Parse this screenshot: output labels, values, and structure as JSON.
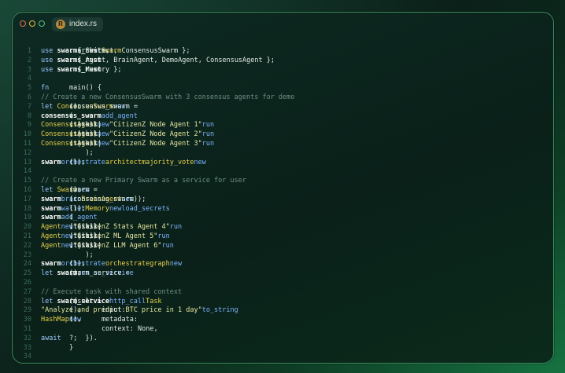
{
  "window": {
    "tab_title": "index.rs",
    "tab_icon": "rust-file-icon",
    "controls": [
      "close",
      "minimize",
      "maximize"
    ]
  },
  "editor": {
    "lines": [
      {
        "n": "1",
        "t": [
          [
            "kw",
            "use "
          ],
          [
            "bold",
            "swarms_rust"
          ],
          [
            "txt",
            "::{ Swarm, "
          ],
          [
            "ty",
            "Swarm"
          ],
          [
            "txt",
            "::architect, ConsensusSwarm };"
          ]
        ]
      },
      {
        "n": "2",
        "t": [
          [
            "kw",
            "use "
          ],
          [
            "bold",
            "swarms_rust"
          ],
          [
            "txt",
            "::{ Agent, BrainAgent, DemoAgent, ConsensusAgent };"
          ]
        ]
      },
      {
        "n": "3",
        "t": [
          [
            "kw",
            "use "
          ],
          [
            "bold",
            "swarms_rust"
          ],
          [
            "txt",
            "::{ Memory };"
          ]
        ]
      },
      {
        "n": "4",
        "t": []
      },
      {
        "n": "5",
        "t": [
          [
            "kw",
            "fn "
          ],
          [
            "txt",
            "main() {"
          ]
        ]
      },
      {
        "n": "6",
        "t": [
          [
            "txt",
            "    "
          ],
          [
            "cm",
            "// Create a new ConsensusSwarm with 3 consensus agents for demo"
          ]
        ]
      },
      {
        "n": "7",
        "t": [
          [
            "txt",
            "    "
          ],
          [
            "kw",
            "let "
          ],
          [
            "txt",
            "consensus_swarm = "
          ],
          [
            "ty",
            "ConsensusSwarm"
          ],
          [
            "txt",
            "::"
          ],
          [
            "fn",
            "new"
          ],
          [
            "txt",
            "();"
          ]
        ]
      },
      {
        "n": "8",
        "t": [
          [
            "txt",
            "    "
          ],
          [
            "bold",
            "consensus_swarm"
          ],
          [
            "txt",
            "."
          ],
          [
            "fn",
            "add_agent"
          ],
          [
            "txt",
            "("
          ]
        ]
      },
      {
        "n": "9",
        "t": [
          [
            "txt",
            "        "
          ],
          [
            "ty",
            "ConsensusAgent"
          ],
          [
            "txt",
            "::"
          ],
          [
            "fn",
            "new"
          ],
          [
            "txt",
            "("
          ],
          [
            "str",
            "\"CitizenZ Node Agent 1\""
          ],
          [
            "txt",
            ", |task| "
          ],
          [
            "fn",
            "run"
          ],
          [
            "txt",
            "(task)),"
          ]
        ]
      },
      {
        "n": "10",
        "t": [
          [
            "txt",
            "        "
          ],
          [
            "ty",
            "ConsensusAgent"
          ],
          [
            "txt",
            "::"
          ],
          [
            "fn",
            "new"
          ],
          [
            "txt",
            "("
          ],
          [
            "str",
            "\"CitizenZ Node Agent 2\""
          ],
          [
            "txt",
            ", |task| "
          ],
          [
            "fn",
            "run"
          ],
          [
            "txt",
            "(task)),"
          ]
        ]
      },
      {
        "n": "11",
        "t": [
          [
            "txt",
            "        "
          ],
          [
            "ty",
            "ConsensusAgent"
          ],
          [
            "txt",
            "::"
          ],
          [
            "fn",
            "new"
          ],
          [
            "txt",
            "("
          ],
          [
            "str",
            "\"CitizenZ Node Agent 3\""
          ],
          [
            "txt",
            ", |task| "
          ],
          [
            "fn",
            "run"
          ],
          [
            "txt",
            "(task))"
          ]
        ]
      },
      {
        "n": "12",
        "t": [
          [
            "txt",
            "    );"
          ]
        ]
      },
      {
        "n": "13",
        "t": [
          [
            "txt",
            "    "
          ],
          [
            "bold",
            "swarm"
          ],
          [
            "txt",
            "."
          ],
          [
            "fn",
            "orchestrate"
          ],
          [
            "txt",
            "("
          ],
          [
            "mod",
            "architect"
          ],
          [
            "txt",
            "::"
          ],
          [
            "mod",
            "majority_vote"
          ],
          [
            "txt",
            "::"
          ],
          [
            "fn",
            "new"
          ],
          [
            "txt",
            "());"
          ]
        ]
      },
      {
        "n": "14",
        "t": []
      },
      {
        "n": "15",
        "t": [
          [
            "txt",
            "    "
          ],
          [
            "cm",
            "// Create a new Primary Swarm as a service for user"
          ]
        ]
      },
      {
        "n": "16",
        "t": [
          [
            "txt",
            "    "
          ],
          [
            "kw",
            "let "
          ],
          [
            "txt",
            "swarm = "
          ],
          [
            "ty",
            "Swarm"
          ],
          [
            "txt",
            "::"
          ],
          [
            "fn",
            "new"
          ],
          [
            "txt",
            "();"
          ]
        ]
      },
      {
        "n": "17",
        "t": [
          [
            "txt",
            "    "
          ],
          [
            "bold",
            "swarm"
          ],
          [
            "txt",
            "."
          ],
          [
            "fn",
            "brain"
          ],
          [
            "txt",
            "("
          ],
          [
            "ty",
            "BrainAgent"
          ],
          [
            "txt",
            "::"
          ],
          [
            "fn",
            "new"
          ],
          [
            "txt",
            "(consensus_swarm));"
          ]
        ]
      },
      {
        "n": "18",
        "t": [
          [
            "txt",
            "    "
          ],
          [
            "bold",
            "swarm"
          ],
          [
            "txt",
            "."
          ],
          [
            "fn",
            "wallet"
          ],
          [
            "txt",
            "("
          ],
          [
            "ty",
            "Memory"
          ],
          [
            "txt",
            "::"
          ],
          [
            "fn",
            "new"
          ],
          [
            "txt",
            "()."
          ],
          [
            "fn",
            "load_secrets"
          ],
          [
            "txt",
            "());"
          ]
        ]
      },
      {
        "n": "19",
        "t": [
          [
            "txt",
            "    "
          ],
          [
            "bold",
            "swarm"
          ],
          [
            "txt",
            "."
          ],
          [
            "fn",
            "add_agent"
          ],
          [
            "txt",
            "("
          ]
        ]
      },
      {
        "n": "20",
        "t": [
          [
            "txt",
            "        "
          ],
          [
            "ty",
            "Agent"
          ],
          [
            "txt",
            "::"
          ],
          [
            "fn",
            "new"
          ],
          [
            "txt",
            "("
          ],
          [
            "str",
            "\"CitizenZ Stats Agent 4\""
          ],
          [
            "txt",
            ", |task| "
          ],
          [
            "fn",
            "run"
          ],
          [
            "txt",
            "(task)),"
          ]
        ]
      },
      {
        "n": "21",
        "t": [
          [
            "txt",
            "        "
          ],
          [
            "ty",
            "Agent"
          ],
          [
            "txt",
            "::"
          ],
          [
            "fn",
            "new"
          ],
          [
            "txt",
            "("
          ],
          [
            "str",
            "\"CitizenZ ML Agent 5\""
          ],
          [
            "txt",
            ", |task| "
          ],
          [
            "fn",
            "run"
          ],
          [
            "txt",
            "(task)),"
          ]
        ]
      },
      {
        "n": "22",
        "t": [
          [
            "txt",
            "        "
          ],
          [
            "ty",
            "Agent"
          ],
          [
            "txt",
            "::"
          ],
          [
            "fn",
            "new"
          ],
          [
            "txt",
            "("
          ],
          [
            "str",
            "\"CitizenZ LLM Agent 6\""
          ],
          [
            "txt",
            ", |task| "
          ],
          [
            "fn",
            "run"
          ],
          [
            "txt",
            "(task))"
          ]
        ]
      },
      {
        "n": "23",
        "t": [
          [
            "txt",
            "    );"
          ]
        ]
      },
      {
        "n": "24",
        "t": [
          [
            "txt",
            "    "
          ],
          [
            "bold",
            "swarm"
          ],
          [
            "txt",
            "."
          ],
          [
            "fn",
            "orchestrate"
          ],
          [
            "txt",
            "("
          ],
          [
            "mod",
            "orchestrate"
          ],
          [
            "txt",
            "::"
          ],
          [
            "mod",
            "graph"
          ],
          [
            "txt",
            "::"
          ],
          [
            "fn",
            "new"
          ],
          [
            "txt",
            "());"
          ]
        ]
      },
      {
        "n": "25",
        "t": [
          [
            "txt",
            "    "
          ],
          [
            "kw",
            "let "
          ],
          [
            "txt",
            "swarm_service = "
          ],
          [
            "bold",
            "swarm"
          ],
          [
            "txt",
            "."
          ],
          [
            "fn",
            "run_as_service"
          ],
          [
            "txt",
            "();"
          ]
        ]
      },
      {
        "n": "26",
        "t": []
      },
      {
        "n": "27",
        "t": [
          [
            "txt",
            "    "
          ],
          [
            "cm",
            "// Execute task with shared context"
          ]
        ]
      },
      {
        "n": "28",
        "t": [
          [
            "txt",
            "    "
          ],
          [
            "kw",
            "let "
          ],
          [
            "txt",
            "result = "
          ],
          [
            "bold",
            "swarm_service"
          ],
          [
            "txt",
            "."
          ],
          [
            "fn",
            "http_call"
          ],
          [
            "txt",
            "("
          ],
          [
            "ty",
            "Task"
          ],
          [
            "txt",
            " {"
          ]
        ]
      },
      {
        "n": "29",
        "t": [
          [
            "txt",
            "        input: "
          ],
          [
            "str",
            "\"Analyze and predict BTC price in 1 day\""
          ],
          [
            "txt",
            "."
          ],
          [
            "fn",
            "to_string"
          ],
          [
            "txt",
            "(),"
          ]
        ]
      },
      {
        "n": "30",
        "t": [
          [
            "txt",
            "        metadata: "
          ],
          [
            "ty",
            "HashMap"
          ],
          [
            "txt",
            "::"
          ],
          [
            "fn",
            "new"
          ],
          [
            "txt",
            "(),"
          ]
        ]
      },
      {
        "n": "31",
        "t": [
          [
            "txt",
            "        context: None,"
          ]
        ]
      },
      {
        "n": "32",
        "t": [
          [
            "txt",
            "    })."
          ],
          [
            "kw",
            "await"
          ],
          [
            "txt",
            "?;"
          ]
        ]
      },
      {
        "n": "33",
        "t": [
          [
            "txt",
            "}"
          ]
        ]
      },
      {
        "n": "34",
        "t": []
      }
    ]
  }
}
